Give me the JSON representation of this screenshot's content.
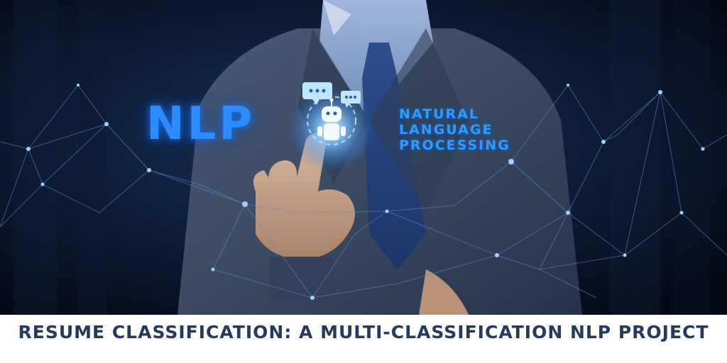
{
  "hero": {
    "logo_text": "NLP",
    "lines": [
      "NATURAL",
      "LANGUAGE",
      "PROCESSING"
    ],
    "robot_icon": "robot-icon",
    "bubble_icon": "chat-bubble-icon"
  },
  "caption": {
    "title": "RESUME CLASSIFICATION: A MULTI-CLASSIFICATION NLP PROJECT"
  },
  "colors": {
    "background": "#081324",
    "glow": "#2a8cff",
    "caption_text": "#253a5c",
    "caption_bg": "#ffffff"
  }
}
